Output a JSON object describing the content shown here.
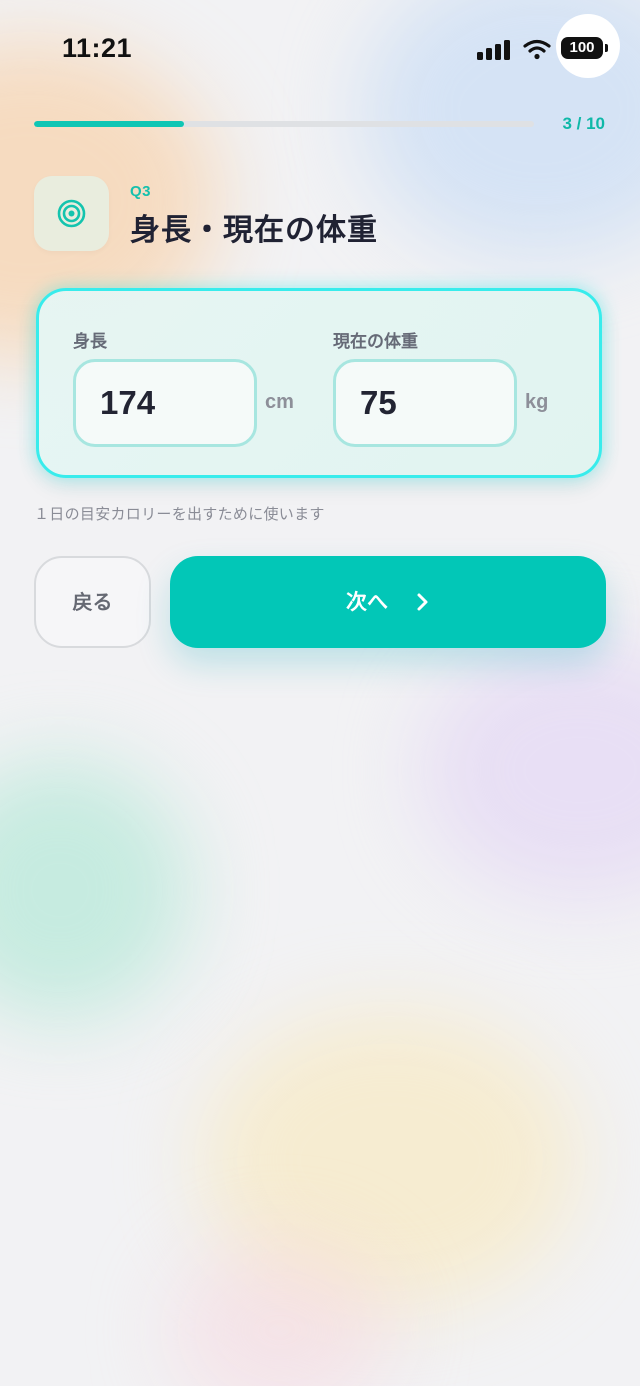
{
  "status_bar": {
    "time": "11:21",
    "battery": "100",
    "icons": [
      "signal-icon",
      "wifi-icon",
      "battery-icon"
    ]
  },
  "progress": {
    "text": "3 / 10",
    "current": 3,
    "total": 10,
    "fraction": 0.3,
    "color": "#0FC6B4"
  },
  "question": {
    "number": "Q3",
    "title": "身長・現在の体重",
    "icon": "target-icon"
  },
  "form": {
    "height": {
      "label": "身長",
      "value": "174",
      "unit": "cm"
    },
    "weight": {
      "label": "現在の体重",
      "value": "75",
      "unit": "kg"
    }
  },
  "helper_text": "１日の目安カロリーを出すために使います",
  "buttons": {
    "back_label": "戻る",
    "next_label": "次へ",
    "next_icon": "chevron-right-icon"
  },
  "colors": {
    "accent": "#00C7B7",
    "title_text": "#202233",
    "card_border_glow": "#38ECEC"
  }
}
